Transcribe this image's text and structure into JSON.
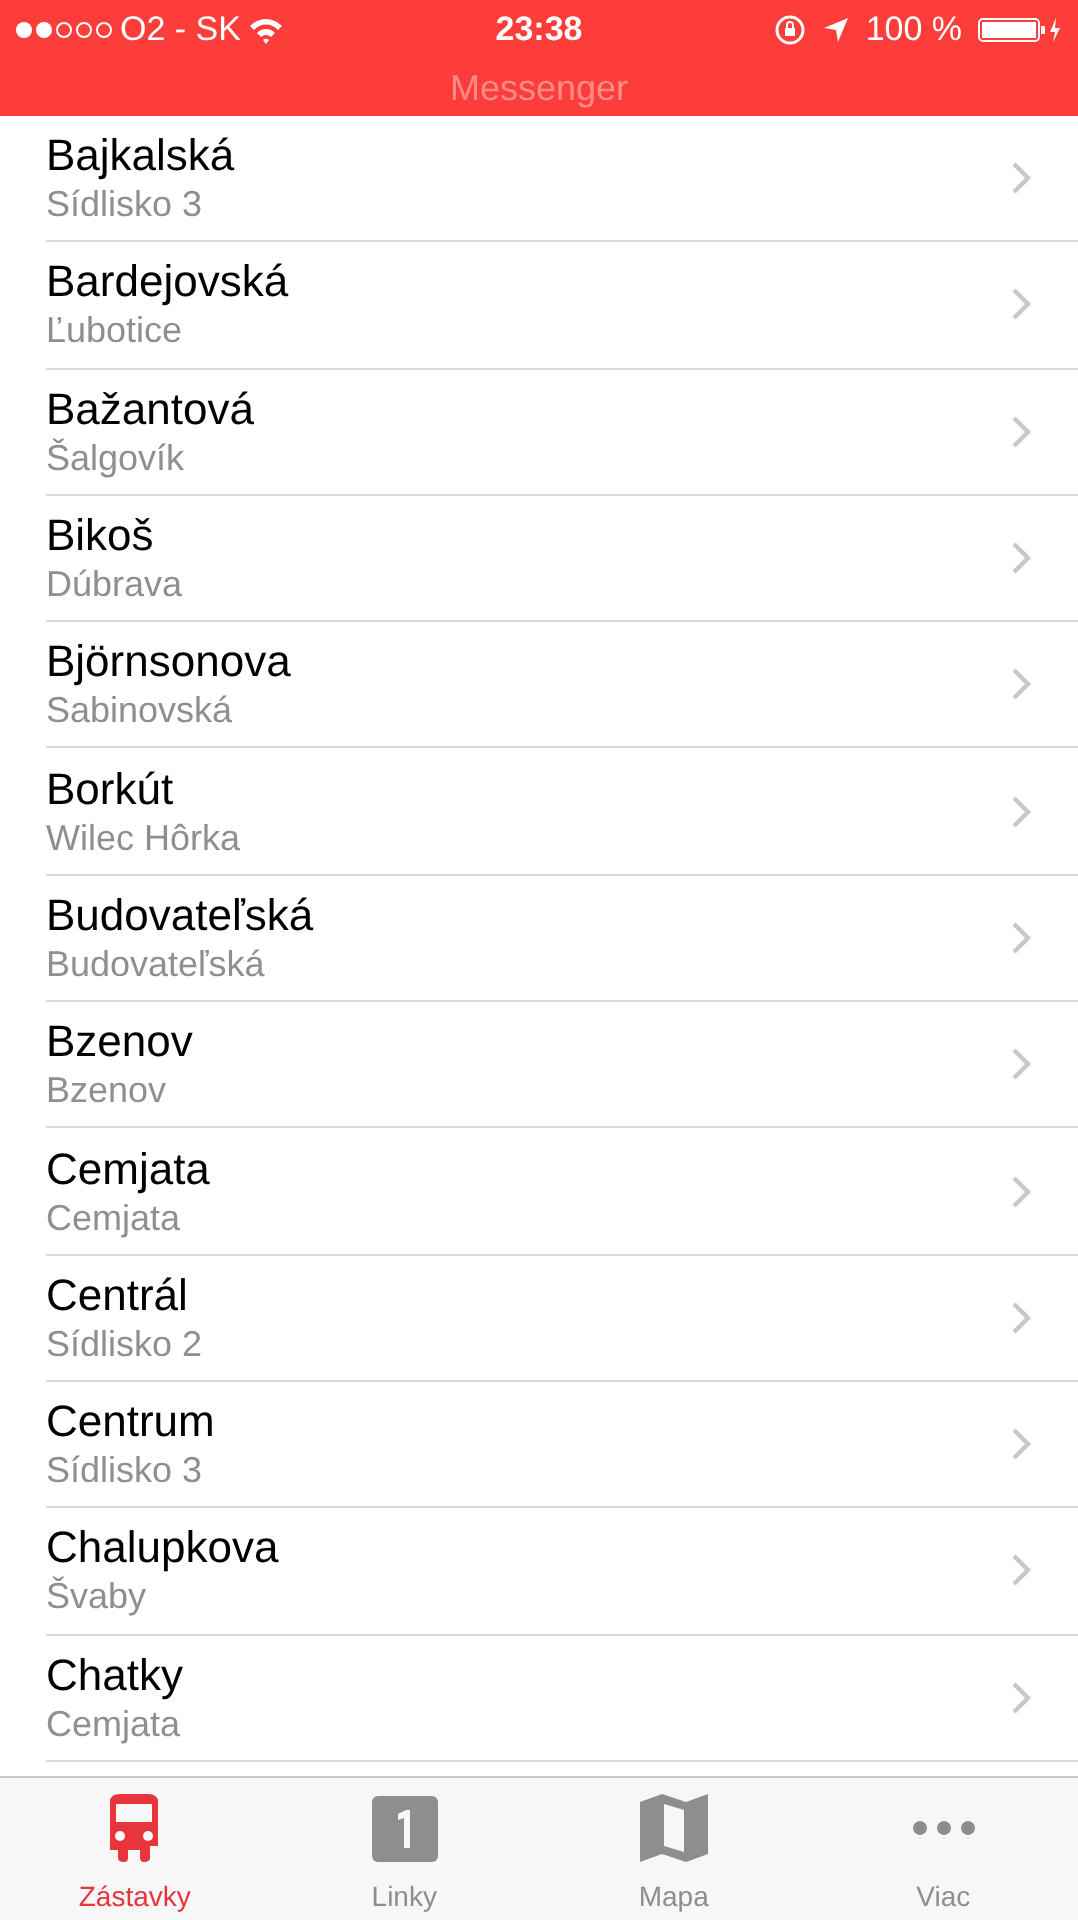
{
  "status_bar": {
    "carrier": "O2 - SK",
    "time": "23:38",
    "battery": "100 %"
  },
  "nav": {
    "title": "Messenger"
  },
  "stops": [
    {
      "name": "Bajkalská",
      "area": "Sídlisko 3"
    },
    {
      "name": "Bardejovská",
      "area": "Ľubotice"
    },
    {
      "name": "Bažantová",
      "area": "Šalgovík"
    },
    {
      "name": "Bikoš",
      "area": "Dúbrava"
    },
    {
      "name": "Björnsonova",
      "area": "Sabinovská"
    },
    {
      "name": "Borkút",
      "area": "Wilec Hôrka"
    },
    {
      "name": "Budovateľská",
      "area": "Budovateľská"
    },
    {
      "name": "Bzenov",
      "area": "Bzenov"
    },
    {
      "name": "Cemjata",
      "area": "Cemjata"
    },
    {
      "name": "Centrál",
      "area": "Sídlisko 2"
    },
    {
      "name": "Centrum",
      "area": "Sídlisko 3"
    },
    {
      "name": "Chalupkova",
      "area": "Švaby"
    },
    {
      "name": "Chatky",
      "area": "Cemjata"
    }
  ],
  "tabs": [
    {
      "label": "Zástavky",
      "kind": "bus",
      "selected": true
    },
    {
      "label": "Linky",
      "kind": "number",
      "selected": false
    },
    {
      "label": "Mapa",
      "kind": "map",
      "selected": false
    },
    {
      "label": "Viac",
      "kind": "more",
      "selected": false
    }
  ]
}
